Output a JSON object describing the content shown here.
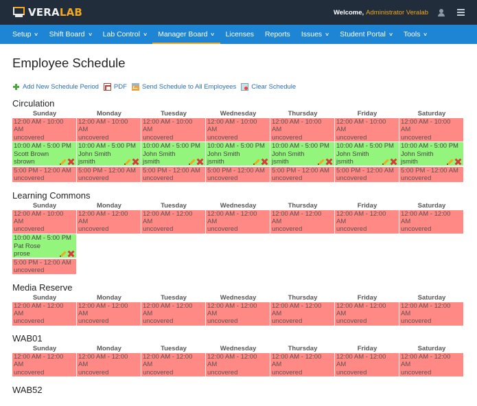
{
  "brand": {
    "name_part1": "VERA",
    "name_part2": "LAB"
  },
  "header": {
    "welcome": "Welcome,",
    "user_name": "Administrator Veralab"
  },
  "nav": [
    {
      "label": "Setup",
      "dropdown": true,
      "active": false
    },
    {
      "label": "Shift Board",
      "dropdown": true,
      "active": false
    },
    {
      "label": "Lab Control",
      "dropdown": true,
      "active": false
    },
    {
      "label": "Manager Board",
      "dropdown": true,
      "active": true
    },
    {
      "label": "Licenses",
      "dropdown": false,
      "active": false
    },
    {
      "label": "Reports",
      "dropdown": false,
      "active": false
    },
    {
      "label": "Issues",
      "dropdown": true,
      "active": false
    },
    {
      "label": "Student Portal",
      "dropdown": true,
      "active": false
    },
    {
      "label": "Tools",
      "dropdown": true,
      "active": false
    }
  ],
  "page": {
    "title": "Employee Schedule"
  },
  "actions": [
    {
      "label": "Add New Schedule Period",
      "icon": "plus-icon"
    },
    {
      "label": "PDF",
      "icon": "pdf-icon"
    },
    {
      "label": "Send Schedule to All Employees",
      "icon": "mail-icon"
    },
    {
      "label": "Clear Schedule",
      "icon": "clear-schedule-icon"
    }
  ],
  "days": [
    "Sunday",
    "Monday",
    "Tuesday",
    "Wednesday",
    "Thursday",
    "Friday",
    "Saturday"
  ],
  "sections": [
    {
      "title": "Circulation",
      "columns": [
        [
          {
            "time": "12:00 AM - 10:00 AM",
            "status": "uncovered"
          },
          {
            "time": "10:00 AM - 5:00 PM",
            "name": "Scott Brown",
            "username": "sbrown",
            "status": "covered"
          },
          {
            "time": "5:00 PM - 12:00 AM",
            "status": "uncovered"
          }
        ],
        [
          {
            "time": "12:00 AM - 10:00 AM",
            "status": "uncovered"
          },
          {
            "time": "10:00 AM - 5:00 PM",
            "name": "John Smith",
            "username": "jsmith",
            "status": "covered"
          },
          {
            "time": "5:00 PM - 12:00 AM",
            "status": "uncovered"
          }
        ],
        [
          {
            "time": "12:00 AM - 10:00 AM",
            "status": "uncovered"
          },
          {
            "time": "10:00 AM - 5:00 PM",
            "name": "John Smith",
            "username": "jsmith",
            "status": "covered"
          },
          {
            "time": "5:00 PM - 12:00 AM",
            "status": "uncovered"
          }
        ],
        [
          {
            "time": "12:00 AM - 10:00 AM",
            "status": "uncovered"
          },
          {
            "time": "10:00 AM - 5:00 PM",
            "name": "John Smith",
            "username": "jsmith",
            "status": "covered"
          },
          {
            "time": "5:00 PM - 12:00 AM",
            "status": "uncovered"
          }
        ],
        [
          {
            "time": "12:00 AM - 10:00 AM",
            "status": "uncovered"
          },
          {
            "time": "10:00 AM - 5:00 PM",
            "name": "John Smith",
            "username": "jsmith",
            "status": "covered"
          },
          {
            "time": "5:00 PM - 12:00 AM",
            "status": "uncovered"
          }
        ],
        [
          {
            "time": "12:00 AM - 10:00 AM",
            "status": "uncovered"
          },
          {
            "time": "10:00 AM - 5:00 PM",
            "name": "John Smith",
            "username": "jsmith",
            "status": "covered"
          },
          {
            "time": "5:00 PM - 12:00 AM",
            "status": "uncovered"
          }
        ],
        [
          {
            "time": "12:00 AM - 10:00 AM",
            "status": "uncovered"
          },
          {
            "time": "10:00 AM - 5:00 PM",
            "name": "John Smith",
            "username": "jsmith",
            "status": "covered"
          },
          {
            "time": "5:00 PM - 12:00 AM",
            "status": "uncovered"
          }
        ]
      ]
    },
    {
      "title": "Learning Commons",
      "columns": [
        [
          {
            "time": "12:00 AM - 10:00 AM",
            "status": "uncovered"
          },
          {
            "time": "10:00 AM - 5:00 PM",
            "name": "Pat Rose",
            "username": "prose",
            "status": "covered"
          },
          {
            "time": "5:00 PM - 12:00 AM",
            "status": "uncovered"
          }
        ],
        [
          {
            "time": "12:00 AM - 12:00 AM",
            "status": "uncovered"
          }
        ],
        [
          {
            "time": "12:00 AM - 12:00 AM",
            "status": "uncovered"
          }
        ],
        [
          {
            "time": "12:00 AM - 12:00 AM",
            "status": "uncovered"
          }
        ],
        [
          {
            "time": "12:00 AM - 12:00 AM",
            "status": "uncovered"
          }
        ],
        [
          {
            "time": "12:00 AM - 12:00 AM",
            "status": "uncovered"
          }
        ],
        [
          {
            "time": "12:00 AM - 12:00 AM",
            "status": "uncovered"
          }
        ]
      ]
    },
    {
      "title": "Media Reserve",
      "columns": [
        [
          {
            "time": "12:00 AM - 12:00 AM",
            "status": "uncovered"
          }
        ],
        [
          {
            "time": "12:00 AM - 12:00 AM",
            "status": "uncovered"
          }
        ],
        [
          {
            "time": "12:00 AM - 12:00 AM",
            "status": "uncovered"
          }
        ],
        [
          {
            "time": "12:00 AM - 12:00 AM",
            "status": "uncovered"
          }
        ],
        [
          {
            "time": "12:00 AM - 12:00 AM",
            "status": "uncovered"
          }
        ],
        [
          {
            "time": "12:00 AM - 12:00 AM",
            "status": "uncovered"
          }
        ],
        [
          {
            "time": "12:00 AM - 12:00 AM",
            "status": "uncovered"
          }
        ]
      ]
    },
    {
      "title": "WAB01",
      "columns": [
        [
          {
            "time": "12:00 AM - 12:00 AM",
            "status": "uncovered"
          }
        ],
        [
          {
            "time": "12:00 AM - 12:00 AM",
            "status": "uncovered"
          }
        ],
        [
          {
            "time": "12:00 AM - 12:00 AM",
            "status": "uncovered"
          }
        ],
        [
          {
            "time": "12:00 AM - 12:00 AM",
            "status": "uncovered"
          }
        ],
        [
          {
            "time": "12:00 AM - 12:00 AM",
            "status": "uncovered"
          }
        ],
        [
          {
            "time": "12:00 AM - 12:00 AM",
            "status": "uncovered"
          }
        ],
        [
          {
            "time": "12:00 AM - 12:00 AM",
            "status": "uncovered"
          }
        ]
      ]
    },
    {
      "title": "WAB52",
      "columns": []
    }
  ],
  "colors": {
    "uncovered": "#ff8a85",
    "covered": "#94f57c",
    "nav": "#1e84d4",
    "topbar": "#222d3b",
    "accent": "#f3a81d"
  }
}
